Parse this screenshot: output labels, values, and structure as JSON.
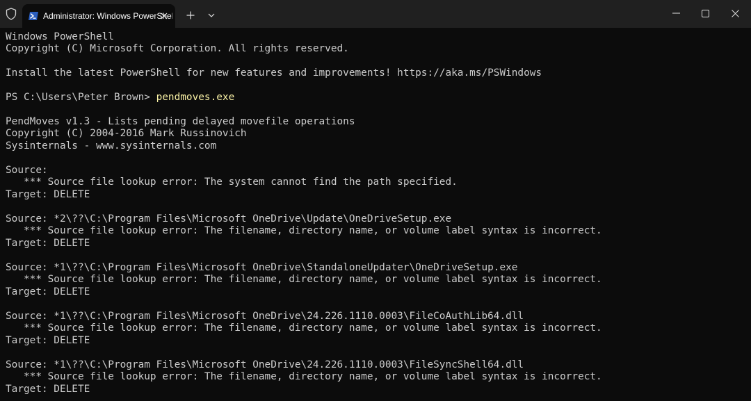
{
  "titlebar": {
    "tab_title": "Administrator: Windows PowerShell",
    "icons": {
      "shield": "shield-icon",
      "powershell": "powershell-icon",
      "close_tab": "close-icon",
      "new_tab": "plus-icon",
      "dropdown": "chevron-down-icon",
      "minimize": "minimize-icon",
      "maximize": "maximize-icon",
      "close_window": "close-icon"
    }
  },
  "colors": {
    "terminal_bg": "#0c0c0c",
    "titlebar_bg": "#202020",
    "text": "#cccccc",
    "command": "#f9f1a5",
    "powershell_blue": "#2a5ebf"
  },
  "terminal": {
    "header_line_1": "Windows PowerShell",
    "header_line_2": "Copyright (C) Microsoft Corporation. All rights reserved.",
    "install_line": "Install the latest PowerShell for new features and improvements! https://aka.ms/PSWindows",
    "prompt": "PS C:\\Users\\Peter Brown> ",
    "command": "pendmoves.exe",
    "tool_line_1": "PendMoves v1.3 - Lists pending delayed movefile operations",
    "tool_line_2": "Copyright (C) 2004-2016 Mark Russinovich",
    "tool_line_3": "Sysinternals - www.sysinternals.com",
    "entries": [
      {
        "source": "Source:",
        "error": "   *** Source file lookup error: The system cannot find the path specified.",
        "target": "Target: DELETE"
      },
      {
        "source": "Source: *2\\??\\C:\\Program Files\\Microsoft OneDrive\\Update\\OneDriveSetup.exe",
        "error": "   *** Source file lookup error: The filename, directory name, or volume label syntax is incorrect.",
        "target": "Target: DELETE"
      },
      {
        "source": "Source: *1\\??\\C:\\Program Files\\Microsoft OneDrive\\StandaloneUpdater\\OneDriveSetup.exe",
        "error": "   *** Source file lookup error: The filename, directory name, or volume label syntax is incorrect.",
        "target": "Target: DELETE"
      },
      {
        "source": "Source: *1\\??\\C:\\Program Files\\Microsoft OneDrive\\24.226.1110.0003\\FileCoAuthLib64.dll",
        "error": "   *** Source file lookup error: The filename, directory name, or volume label syntax is incorrect.",
        "target": "Target: DELETE"
      },
      {
        "source": "Source: *1\\??\\C:\\Program Files\\Microsoft OneDrive\\24.226.1110.0003\\FileSyncShell64.dll",
        "error": "   *** Source file lookup error: The filename, directory name, or volume label syntax is incorrect.",
        "target": "Target: DELETE"
      }
    ]
  }
}
